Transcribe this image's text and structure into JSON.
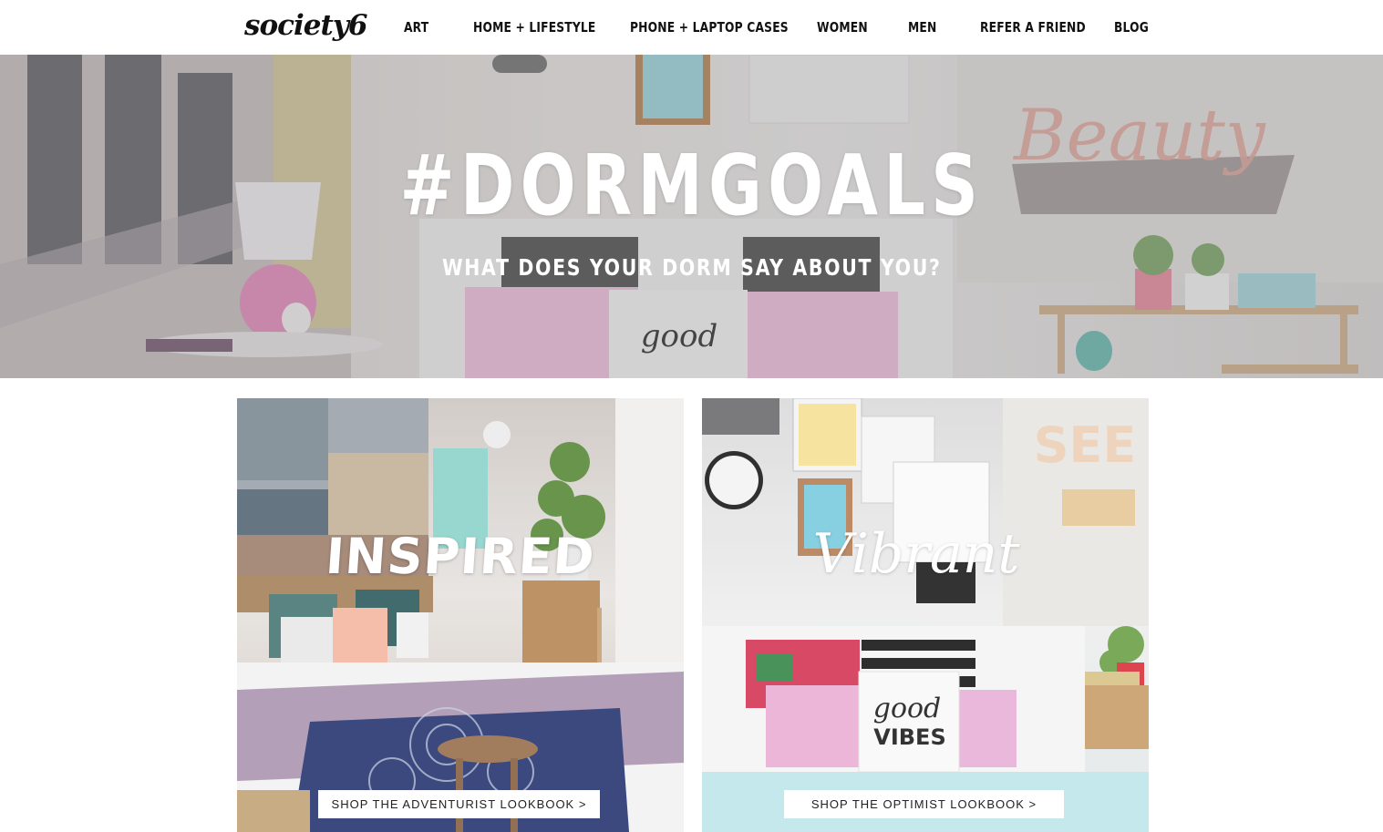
{
  "brand": {
    "logo": "society6"
  },
  "nav": {
    "items": [
      {
        "label": "ART"
      },
      {
        "label": "HOME + LIFESTYLE"
      },
      {
        "label": "PHONE + LAPTOP CASES"
      },
      {
        "label": "WOMEN"
      },
      {
        "label": "MEN"
      },
      {
        "label": "REFER A FRIEND"
      },
      {
        "label": "BLOG"
      }
    ]
  },
  "hero": {
    "title": "#DORMGOALS",
    "subtitle": "WHAT DOES YOUR DORM SAY ABOUT YOU?"
  },
  "lookbooks": [
    {
      "title": "INSPIRED",
      "button": "SHOP THE ADVENTURIST LOOKBOOK >"
    },
    {
      "title": "Vibrant",
      "button": "SHOP THE OPTIMIST LOOKBOOK >"
    }
  ],
  "colors": {
    "nav_text": "#111111",
    "hero_text": "#ffffff",
    "button_bg": "#ffffff"
  }
}
